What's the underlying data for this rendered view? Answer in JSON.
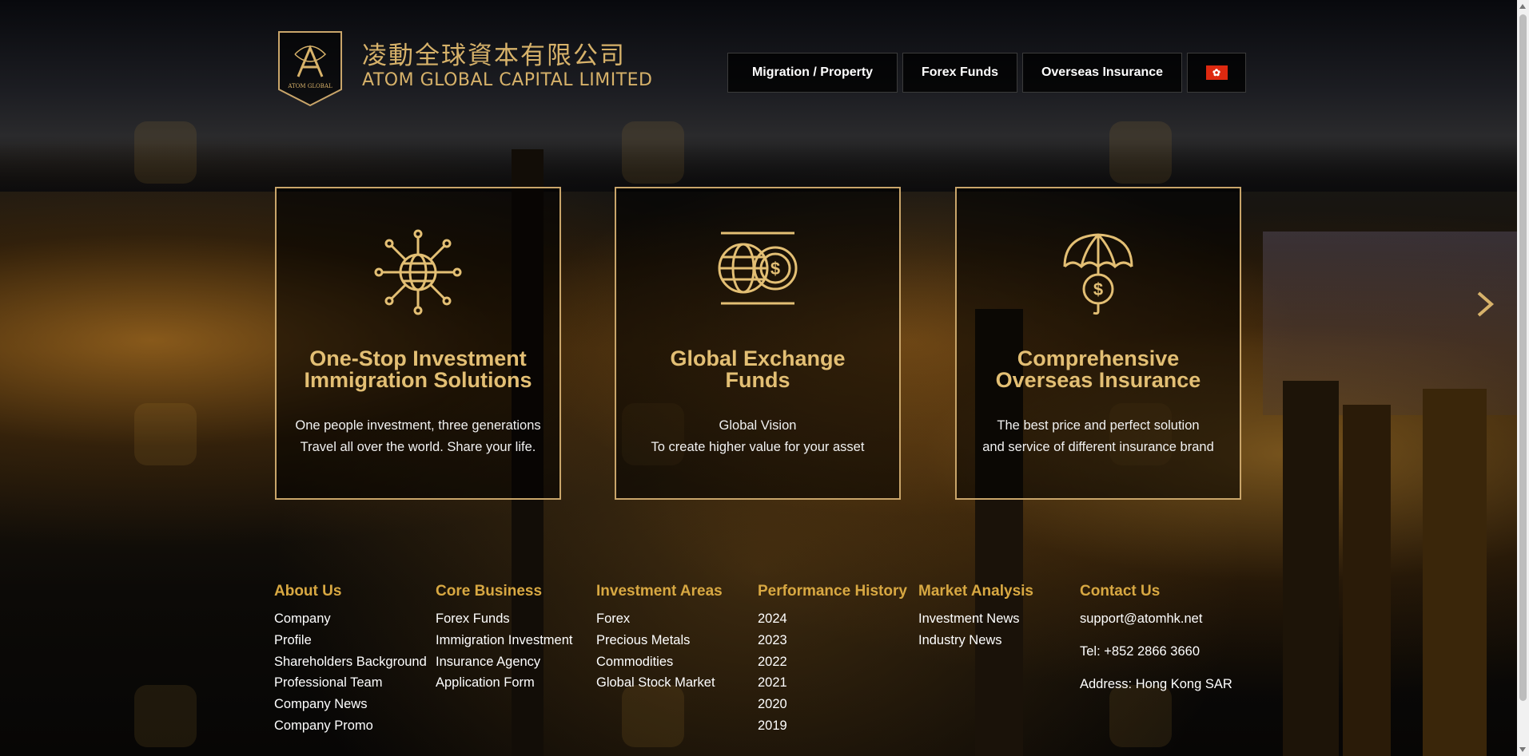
{
  "brand": {
    "name_cn": "凌動全球資本有限公司",
    "name_en": "ATOM GLOBAL CAPITAL LIMITED",
    "logo_text": "ATOM GLOBAL"
  },
  "nav": {
    "items": [
      {
        "label": "Migration / Property"
      },
      {
        "label": "Forex Funds"
      },
      {
        "label": "Overseas Insurance"
      }
    ],
    "language_flag_icon": "hong-kong-flag-icon"
  },
  "cards": [
    {
      "icon": "globe-network-icon",
      "title_line1": "One-Stop Investment",
      "title_line2": "Immigration Solutions",
      "desc_line1": "One people investment, three generations",
      "desc_line2": "Travel all over the world. Share your life."
    },
    {
      "icon": "globe-dollar-icon",
      "title_line1": "Global Exchange",
      "title_line2": "Funds",
      "desc_line1": "Global Vision",
      "desc_line2": "To create higher value for your asset"
    },
    {
      "icon": "umbrella-dollar-icon",
      "title_line1": "Comprehensive",
      "title_line2": "Overseas Insurance",
      "desc_line1": "The best price and perfect solution",
      "desc_line2": "and service of different insurance brand"
    }
  ],
  "footer": {
    "about": {
      "title": "About Us",
      "links": [
        "Company",
        "Profile",
        "Shareholders Background",
        "Professional Team",
        "Company News",
        "Company Promo"
      ]
    },
    "core": {
      "title": "Core Business",
      "links": [
        "Forex Funds",
        "Immigration Investment",
        "Insurance Agency",
        "Application Form"
      ]
    },
    "invest": {
      "title": "Investment Areas",
      "links": [
        "Forex",
        "Precious Metals",
        "Commodities",
        "Global Stock Market"
      ]
    },
    "perf": {
      "title": "Performance History",
      "links": [
        "2024",
        "2023",
        "2022",
        "2021",
        "2020",
        "2019"
      ]
    },
    "market": {
      "title": "Market Analysis",
      "links": [
        "Investment News",
        "Industry News"
      ]
    },
    "contact": {
      "title": "Contact Us",
      "email": "support@atomhk.net",
      "tel": "Tel: +852 2866 3660",
      "address": "Address: Hong Kong SAR"
    }
  },
  "colors": {
    "gold": "#d7b26a",
    "footer_heading": "#d8a842",
    "card_border": "#c9a56a"
  }
}
